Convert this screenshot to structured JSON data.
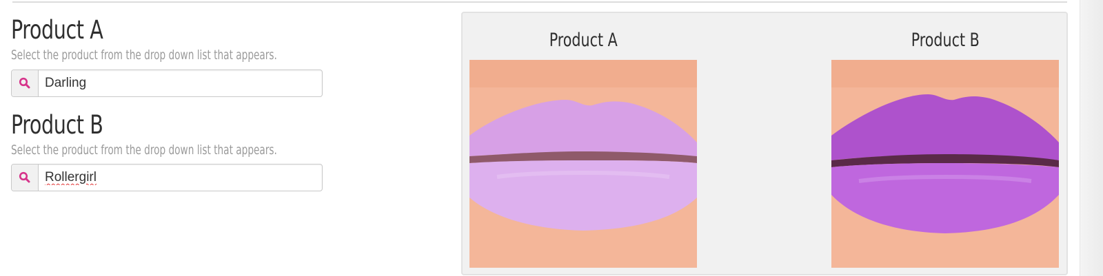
{
  "product_a": {
    "title": "Product A",
    "help_text": "Select the product from the drop down list that appears.",
    "search_value": "Darling",
    "icon": "search-icon"
  },
  "product_b": {
    "title": "Product B",
    "help_text": "Select the product from the drop down list that appears.",
    "search_value": "Rollergirl",
    "icon": "search-icon"
  },
  "comparison": {
    "label_a": "Product A",
    "label_b": "Product B",
    "image_a": {
      "subject": "lips-swatch",
      "color": "#dba4ea"
    },
    "image_b": {
      "subject": "lips-swatch",
      "color": "#b35ad2"
    }
  },
  "colors": {
    "accent": "#d6338a",
    "skin": "#f4b699",
    "panel_bg": "#f1f1f1"
  }
}
